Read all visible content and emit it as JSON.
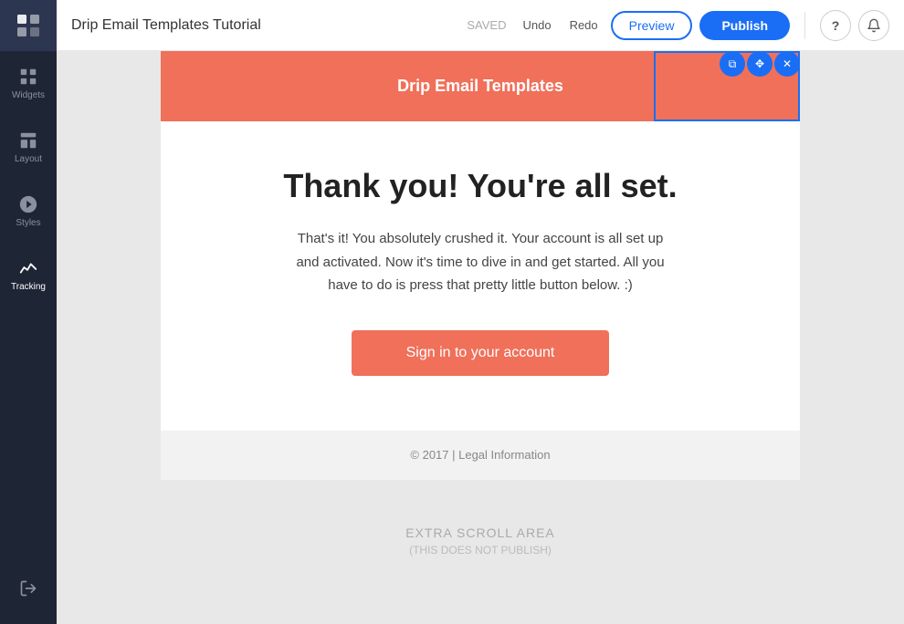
{
  "sidebar": {
    "logo_alt": "Drip logo",
    "items": [
      {
        "id": "widgets",
        "label": "Widgets",
        "icon": "grid"
      },
      {
        "id": "layout",
        "label": "Layout",
        "icon": "layout"
      },
      {
        "id": "styles",
        "label": "Styles",
        "icon": "styles"
      },
      {
        "id": "tracking",
        "label": "Tracking",
        "icon": "tracking"
      }
    ],
    "bottom_items": [
      {
        "id": "exit",
        "label": "Exit",
        "icon": "exit"
      }
    ]
  },
  "topbar": {
    "title": "Drip Email Templates Tutorial",
    "saved_label": "SAVED",
    "undo_label": "Undo",
    "redo_label": "Redo",
    "preview_label": "Preview",
    "publish_label": "Publish"
  },
  "email": {
    "header_title": "Drip Email Templates",
    "content_heading": "Thank you! You're all set.",
    "content_body": "That's it! You absolutely crushed it. Your account is all set up and activated. Now it's time to dive in and get started. All you have to do is press that pretty little button below. :)",
    "cta_label": "Sign in to your account",
    "footer_text": "© 2017 | Legal Information"
  },
  "extra_scroll": {
    "label": "EXTRA SCROLL AREA",
    "sublabel": "(THIS DOES NOT PUBLISH)"
  },
  "block_actions": {
    "copy_icon": "⧉",
    "move_icon": "✥",
    "delete_icon": "✕"
  },
  "colors": {
    "accent": "#1a6ef5",
    "coral": "#f0705a",
    "sidebar_bg": "#1e2535"
  }
}
